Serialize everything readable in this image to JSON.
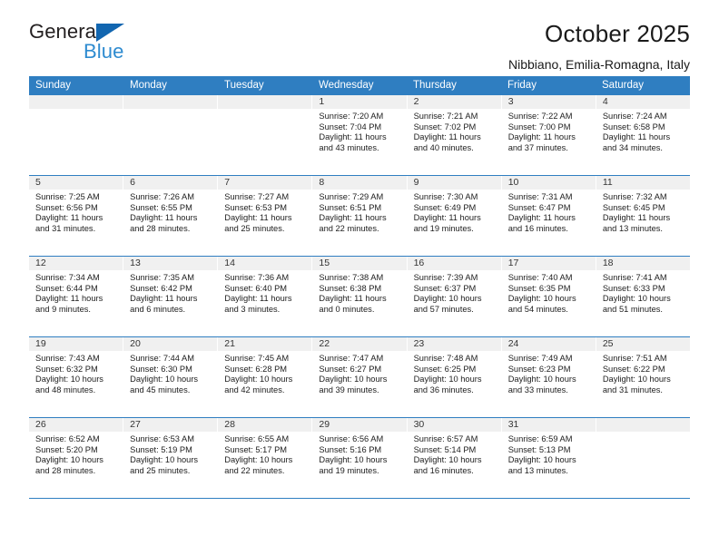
{
  "brand": {
    "line1": "General",
    "line2": "Blue",
    "triangle_color": "#1266b0",
    "line2_color": "#2e8bd0"
  },
  "header": {
    "title": "October 2025",
    "subtitle": "Nibbiano, Emilia-Romagna, Italy"
  },
  "calendar": {
    "header_color": "#2f7ec1",
    "daynum_strip_color": "#f0f0f0",
    "weekdays": [
      "Sunday",
      "Monday",
      "Tuesday",
      "Wednesday",
      "Thursday",
      "Friday",
      "Saturday"
    ],
    "labels": {
      "sunrise": "Sunrise:",
      "sunset": "Sunset:",
      "daylight": "Daylight:"
    },
    "weeks": [
      [
        {
          "day": ""
        },
        {
          "day": ""
        },
        {
          "day": ""
        },
        {
          "day": "1",
          "sunrise": "Sunrise: 7:20 AM",
          "sunset": "Sunset: 7:04 PM",
          "daylight1": "Daylight: 11 hours",
          "daylight2": "and 43 minutes."
        },
        {
          "day": "2",
          "sunrise": "Sunrise: 7:21 AM",
          "sunset": "Sunset: 7:02 PM",
          "daylight1": "Daylight: 11 hours",
          "daylight2": "and 40 minutes."
        },
        {
          "day": "3",
          "sunrise": "Sunrise: 7:22 AM",
          "sunset": "Sunset: 7:00 PM",
          "daylight1": "Daylight: 11 hours",
          "daylight2": "and 37 minutes."
        },
        {
          "day": "4",
          "sunrise": "Sunrise: 7:24 AM",
          "sunset": "Sunset: 6:58 PM",
          "daylight1": "Daylight: 11 hours",
          "daylight2": "and 34 minutes."
        }
      ],
      [
        {
          "day": "5",
          "sunrise": "Sunrise: 7:25 AM",
          "sunset": "Sunset: 6:56 PM",
          "daylight1": "Daylight: 11 hours",
          "daylight2": "and 31 minutes."
        },
        {
          "day": "6",
          "sunrise": "Sunrise: 7:26 AM",
          "sunset": "Sunset: 6:55 PM",
          "daylight1": "Daylight: 11 hours",
          "daylight2": "and 28 minutes."
        },
        {
          "day": "7",
          "sunrise": "Sunrise: 7:27 AM",
          "sunset": "Sunset: 6:53 PM",
          "daylight1": "Daylight: 11 hours",
          "daylight2": "and 25 minutes."
        },
        {
          "day": "8",
          "sunrise": "Sunrise: 7:29 AM",
          "sunset": "Sunset: 6:51 PM",
          "daylight1": "Daylight: 11 hours",
          "daylight2": "and 22 minutes."
        },
        {
          "day": "9",
          "sunrise": "Sunrise: 7:30 AM",
          "sunset": "Sunset: 6:49 PM",
          "daylight1": "Daylight: 11 hours",
          "daylight2": "and 19 minutes."
        },
        {
          "day": "10",
          "sunrise": "Sunrise: 7:31 AM",
          "sunset": "Sunset: 6:47 PM",
          "daylight1": "Daylight: 11 hours",
          "daylight2": "and 16 minutes."
        },
        {
          "day": "11",
          "sunrise": "Sunrise: 7:32 AM",
          "sunset": "Sunset: 6:45 PM",
          "daylight1": "Daylight: 11 hours",
          "daylight2": "and 13 minutes."
        }
      ],
      [
        {
          "day": "12",
          "sunrise": "Sunrise: 7:34 AM",
          "sunset": "Sunset: 6:44 PM",
          "daylight1": "Daylight: 11 hours",
          "daylight2": "and 9 minutes."
        },
        {
          "day": "13",
          "sunrise": "Sunrise: 7:35 AM",
          "sunset": "Sunset: 6:42 PM",
          "daylight1": "Daylight: 11 hours",
          "daylight2": "and 6 minutes."
        },
        {
          "day": "14",
          "sunrise": "Sunrise: 7:36 AM",
          "sunset": "Sunset: 6:40 PM",
          "daylight1": "Daylight: 11 hours",
          "daylight2": "and 3 minutes."
        },
        {
          "day": "15",
          "sunrise": "Sunrise: 7:38 AM",
          "sunset": "Sunset: 6:38 PM",
          "daylight1": "Daylight: 11 hours",
          "daylight2": "and 0 minutes."
        },
        {
          "day": "16",
          "sunrise": "Sunrise: 7:39 AM",
          "sunset": "Sunset: 6:37 PM",
          "daylight1": "Daylight: 10 hours",
          "daylight2": "and 57 minutes."
        },
        {
          "day": "17",
          "sunrise": "Sunrise: 7:40 AM",
          "sunset": "Sunset: 6:35 PM",
          "daylight1": "Daylight: 10 hours",
          "daylight2": "and 54 minutes."
        },
        {
          "day": "18",
          "sunrise": "Sunrise: 7:41 AM",
          "sunset": "Sunset: 6:33 PM",
          "daylight1": "Daylight: 10 hours",
          "daylight2": "and 51 minutes."
        }
      ],
      [
        {
          "day": "19",
          "sunrise": "Sunrise: 7:43 AM",
          "sunset": "Sunset: 6:32 PM",
          "daylight1": "Daylight: 10 hours",
          "daylight2": "and 48 minutes."
        },
        {
          "day": "20",
          "sunrise": "Sunrise: 7:44 AM",
          "sunset": "Sunset: 6:30 PM",
          "daylight1": "Daylight: 10 hours",
          "daylight2": "and 45 minutes."
        },
        {
          "day": "21",
          "sunrise": "Sunrise: 7:45 AM",
          "sunset": "Sunset: 6:28 PM",
          "daylight1": "Daylight: 10 hours",
          "daylight2": "and 42 minutes."
        },
        {
          "day": "22",
          "sunrise": "Sunrise: 7:47 AM",
          "sunset": "Sunset: 6:27 PM",
          "daylight1": "Daylight: 10 hours",
          "daylight2": "and 39 minutes."
        },
        {
          "day": "23",
          "sunrise": "Sunrise: 7:48 AM",
          "sunset": "Sunset: 6:25 PM",
          "daylight1": "Daylight: 10 hours",
          "daylight2": "and 36 minutes."
        },
        {
          "day": "24",
          "sunrise": "Sunrise: 7:49 AM",
          "sunset": "Sunset: 6:23 PM",
          "daylight1": "Daylight: 10 hours",
          "daylight2": "and 33 minutes."
        },
        {
          "day": "25",
          "sunrise": "Sunrise: 7:51 AM",
          "sunset": "Sunset: 6:22 PM",
          "daylight1": "Daylight: 10 hours",
          "daylight2": "and 31 minutes."
        }
      ],
      [
        {
          "day": "26",
          "sunrise": "Sunrise: 6:52 AM",
          "sunset": "Sunset: 5:20 PM",
          "daylight1": "Daylight: 10 hours",
          "daylight2": "and 28 minutes."
        },
        {
          "day": "27",
          "sunrise": "Sunrise: 6:53 AM",
          "sunset": "Sunset: 5:19 PM",
          "daylight1": "Daylight: 10 hours",
          "daylight2": "and 25 minutes."
        },
        {
          "day": "28",
          "sunrise": "Sunrise: 6:55 AM",
          "sunset": "Sunset: 5:17 PM",
          "daylight1": "Daylight: 10 hours",
          "daylight2": "and 22 minutes."
        },
        {
          "day": "29",
          "sunrise": "Sunrise: 6:56 AM",
          "sunset": "Sunset: 5:16 PM",
          "daylight1": "Daylight: 10 hours",
          "daylight2": "and 19 minutes."
        },
        {
          "day": "30",
          "sunrise": "Sunrise: 6:57 AM",
          "sunset": "Sunset: 5:14 PM",
          "daylight1": "Daylight: 10 hours",
          "daylight2": "and 16 minutes."
        },
        {
          "day": "31",
          "sunrise": "Sunrise: 6:59 AM",
          "sunset": "Sunset: 5:13 PM",
          "daylight1": "Daylight: 10 hours",
          "daylight2": "and 13 minutes."
        },
        {
          "day": ""
        }
      ]
    ]
  }
}
